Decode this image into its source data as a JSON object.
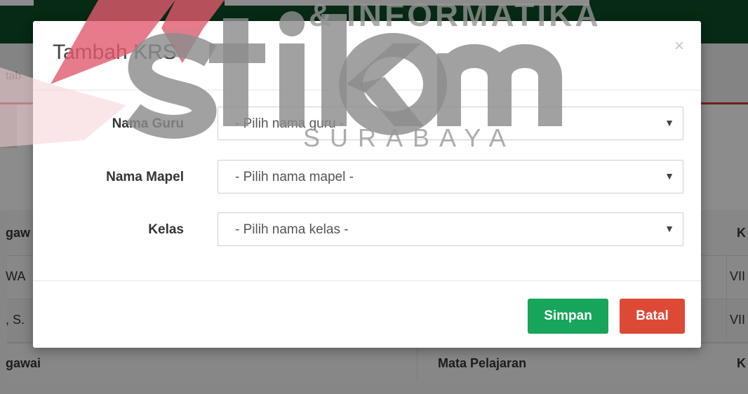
{
  "background": {
    "header_text": "tab",
    "table": {
      "header_1": "gaw",
      "header_right": "K",
      "row_1_col_1": "WA",
      "row_1_col_3": "VII",
      "row_2_col_1": ", S.",
      "row_2_col_3": "VII",
      "footer_col_1": "gawai",
      "footer_col_2": "Mata Pelajaran",
      "footer_col_3": "K"
    }
  },
  "modal": {
    "title": "Tambah KRS",
    "close_symbol": "×",
    "fields": [
      {
        "label": "Nama Guru",
        "value": "- Pilih nama guru -"
      },
      {
        "label": "Nama Mapel",
        "value": "- Pilih nama mapel -"
      },
      {
        "label": "Kelas",
        "value": "- Pilih nama kelas -"
      }
    ],
    "dropdown_arrow": "▼",
    "save_label": "Simpan",
    "cancel_label": "Batal"
  },
  "watermark": {
    "brand": "stikom",
    "tagline_top": "& INFORMATIKA",
    "tagline_bottom": "SURABAYA"
  },
  "colors": {
    "topbar": "#0b4d24",
    "save_button": "#16a55a",
    "cancel_button": "#dc4a36",
    "header_accent_line": "#c9402f"
  }
}
